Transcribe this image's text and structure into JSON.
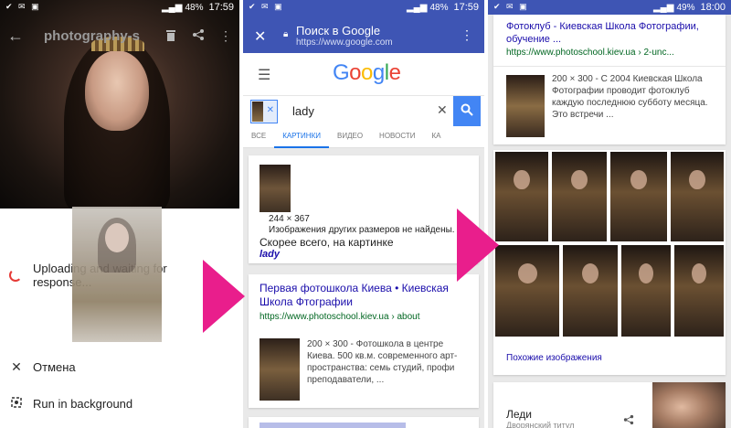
{
  "screen1": {
    "status": {
      "battery": "48%",
      "time": "17:59"
    },
    "toolbar": {
      "title": "photography-s"
    },
    "upload_text": "Uploading and waiting for response...",
    "menu": [
      {
        "label": "Отмена",
        "icon": "close-icon"
      },
      {
        "label": "Run in background",
        "icon": "background-icon"
      }
    ]
  },
  "screen2": {
    "status": {
      "battery": "48%",
      "time": "17:59"
    },
    "chrome": {
      "title": "Поиск в Google",
      "url": "https://www.google.com"
    },
    "logo": "Google",
    "search": {
      "query": "lady"
    },
    "tabs": [
      "ВСЕ",
      "КАРТИНКИ",
      "ВИДЕО",
      "НОВОСТИ",
      "КА"
    ],
    "result_image": {
      "dimensions": "244 × 367",
      "other_sizes": "Изображения других размеров не найдены.",
      "best_guess": "Скорее всего, на картинке",
      "best_guess_link": "lady"
    },
    "result1": {
      "title": "Первая фотошкола Киева • Киевская Школа Фтографии",
      "url": "https://www.photoschool.kiev.ua › about",
      "snippet": "200 × 300 - Фотошкола в центре Киева. 500 кв.м. современного арт-пространства: семь студий, профи преподаватели, ..."
    }
  },
  "screen3": {
    "status": {
      "battery": "49%",
      "time": "18:00"
    },
    "result": {
      "title": "Фотоклуб - Киевская Школа Фотографии, обучение ...",
      "url": "https://www.photoschool.kiev.ua › 2-unc...",
      "snippet": "200 × 300 - С 2004 Киевская Школа Фотографии проводит фотоклуб каждую последнюю субботу месяца. Это встречи ..."
    },
    "similar_images": "Похожие изображения",
    "bottom": {
      "title": "Леди",
      "subtitle": "Дворянский титул"
    }
  },
  "colors": {
    "accent": "#e91e8c",
    "chrome_blue": "#3e55b4",
    "link": "#1a0dab",
    "url_green": "#006621",
    "google_blue": "#4285f4"
  }
}
